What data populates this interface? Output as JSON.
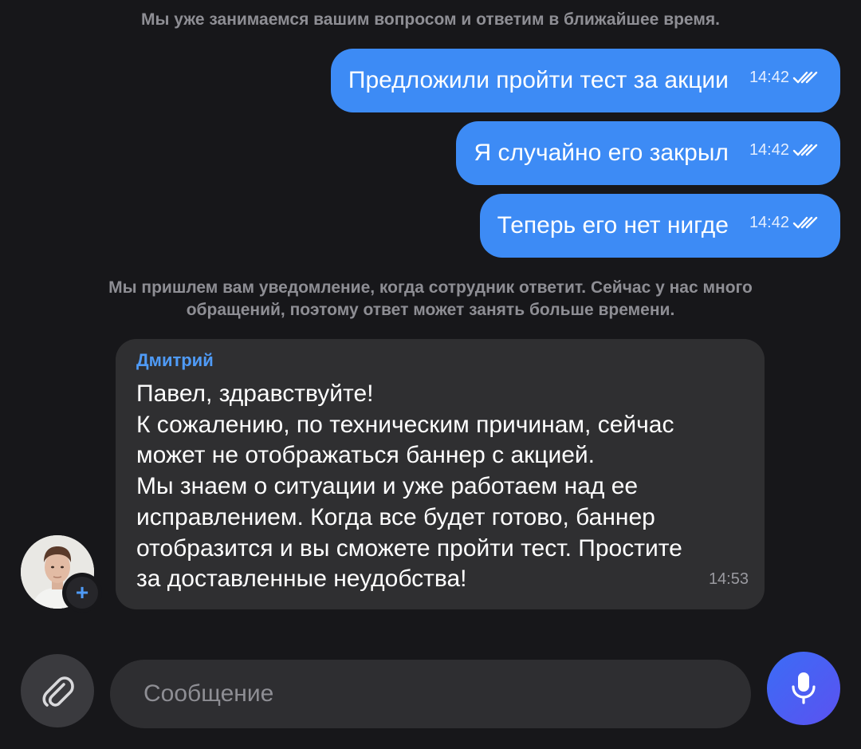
{
  "system_notes": {
    "queue_note": "Мы уже занимаемся вашим вопросом и ответим в ближайшее время.",
    "notify_note_line1": "Мы пришлем вам уведомление, когда сотрудник ответит. Сейчас у нас много",
    "notify_note_line2": "обращений, поэтому ответ может занять больше времени."
  },
  "outgoing_messages": [
    {
      "text": "Предложили пройти тест за акции",
      "time": "14:42",
      "status_icon": "double-check-icon"
    },
    {
      "text": "Я случайно его закрыл",
      "time": "14:42",
      "status_icon": "double-check-icon"
    },
    {
      "text": "Теперь его нет нигде",
      "time": "14:42",
      "status_icon": "double-check-icon"
    }
  ],
  "incoming_message": {
    "sender": "Дмитрий",
    "lines": [
      "Павел, здравствуйте!",
      "К сожалению, по техническим причинам, сейчас",
      "может не отображаться баннер с акцией.",
      "Мы знаем о ситуации и уже работаем над ее",
      "исправлением. Когда все будет готово, баннер",
      "отобразится и вы сможете пройти тест. Простите",
      "за доставленные неудобства!"
    ],
    "time": "14:53",
    "avatar_badge": "+"
  },
  "composer": {
    "placeholder": "Сообщение",
    "attach_icon": "paperclip-icon",
    "mic_icon": "microphone-icon"
  },
  "colors": {
    "background": "#17171a",
    "outgoing_bubble": "#3d8bf5",
    "incoming_bubble": "#2f2f31",
    "sender_name": "#4f9bf7",
    "system_text": "#8e8e94",
    "mic_button": "#4c5ef3"
  }
}
